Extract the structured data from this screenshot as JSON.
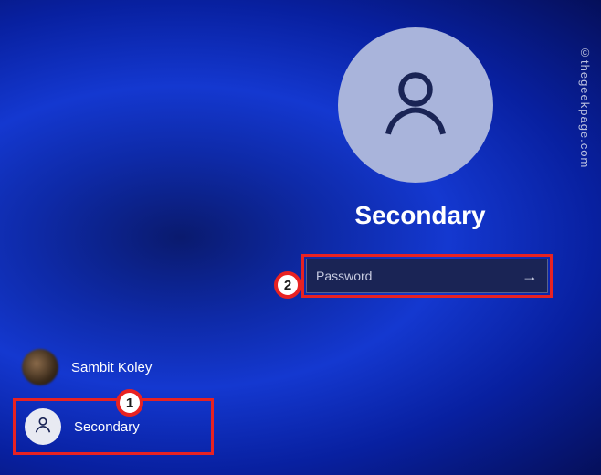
{
  "selected_account": {
    "name": "Secondary"
  },
  "password_field": {
    "placeholder": "Password"
  },
  "users": [
    {
      "label": "Sambit Koley"
    },
    {
      "label": "Secondary"
    }
  ],
  "annotations": {
    "badge1": "1",
    "badge2": "2"
  },
  "watermark": "©thegeekpage.com"
}
